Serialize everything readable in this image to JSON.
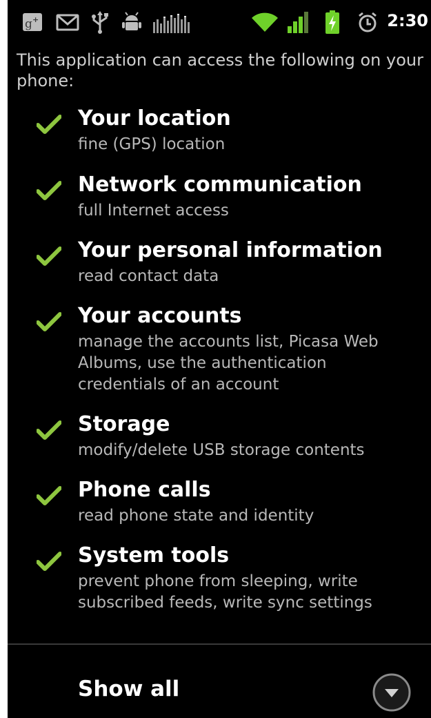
{
  "status_bar": {
    "icons": [
      "google-plus-icon",
      "gmail-icon",
      "usb-icon",
      "android-debug-icon",
      "equalizer-icon",
      "wifi-icon",
      "signal-icon",
      "battery-charging-icon",
      "alarm-icon"
    ],
    "time": "2:30"
  },
  "intro_text": "This application can access the following on your phone:",
  "permissions": [
    {
      "title": "Your location",
      "description": "fine (GPS) location"
    },
    {
      "title": "Network communication",
      "description": "full Internet access"
    },
    {
      "title": "Your personal information",
      "description": "read contact data"
    },
    {
      "title": "Your accounts",
      "description": "manage the accounts list, Picasa Web Albums, use the authentication credentials of an account"
    },
    {
      "title": "Storage",
      "description": "modify/delete USB storage contents"
    },
    {
      "title": "Phone calls",
      "description": "read phone state and identity"
    },
    {
      "title": "System tools",
      "description": "prevent phone from sleeping, write subscribed feeds, write sync settings"
    }
  ],
  "show_all_label": "Show all",
  "colors": {
    "background": "#000000",
    "check": "#8ec63f",
    "accent_green": "#6fd12a",
    "title": "#ffffff",
    "description": "#b8b8b8"
  }
}
